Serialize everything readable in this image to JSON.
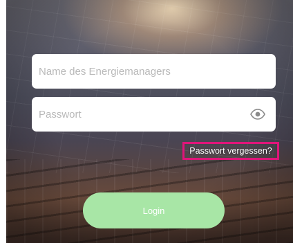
{
  "login_form": {
    "username_placeholder": "Name des Energiemanagers",
    "password_placeholder": "Passwort",
    "forgot_password_label": "Passwort vergessen?",
    "login_label": "Login"
  },
  "icons": {
    "password_toggle": "eye-icon"
  },
  "colors": {
    "login_button": "#a8e6a6",
    "highlight_box": "#e0157a",
    "field_background": "#ffffff"
  }
}
